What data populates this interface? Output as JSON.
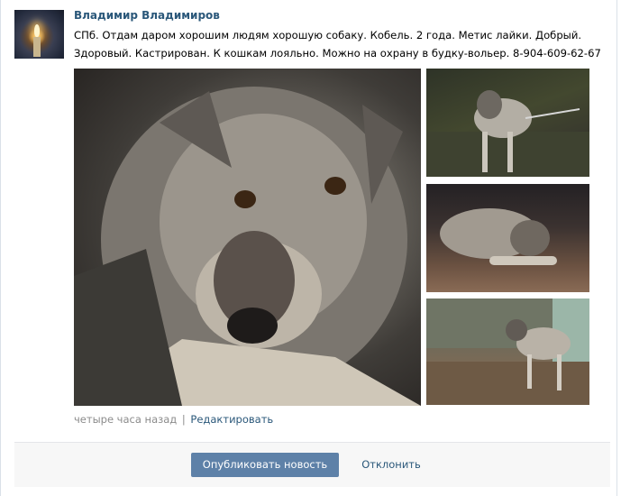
{
  "post": {
    "author": "Владимир Владимиров",
    "text": "СПб. Отдам даром хорошим людям хорошую собаку. Кобель. 2 года. Метис лайки. Добрый. Здоровый. Кастрирован. К кошкам лояльно. Можно на охрану в будку-вольер. 8-904-609-62-67",
    "time": "четыре часа назад",
    "separator": "|",
    "edit_label": "Редактировать"
  },
  "photos": {
    "main": "dog-portrait-photo",
    "thumb1": "dog-on-leash-photo",
    "thumb2": "dog-lying-photo",
    "thumb3": "dog-standing-photo"
  },
  "actions": {
    "publish_label": "Опубликовать новость",
    "decline_label": "Отклонить"
  },
  "colors": {
    "link": "#2b587a",
    "button": "#5e81a8",
    "meta": "#8c8c8c",
    "action_bar": "#f7f7f7"
  }
}
